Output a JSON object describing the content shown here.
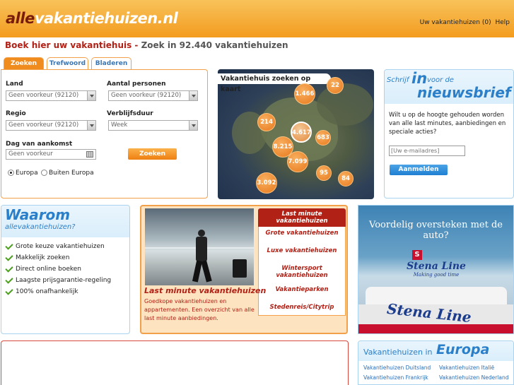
{
  "header": {
    "logo_part1": "alle",
    "logo_part2": "vakantiehuizen.nl",
    "nav_favorites": "Uw vakantiehuizen (0)",
    "nav_help": "Help"
  },
  "headline": {
    "part1": "Boek hier uw vakantiehuis - ",
    "part2": "Zoek in 92.440 vakantiehuizen"
  },
  "search_tabs": [
    "Zoeken",
    "Trefwoord",
    "Bladeren"
  ],
  "search": {
    "land_label": "Land",
    "land_value": "Geen voorkeur (92120)",
    "personen_label": "Aantal personen",
    "personen_value": "Geen voorkeur (92120)",
    "regio_label": "Regio",
    "regio_value": "Geen voorkeur (92120)",
    "verblijfsduur_label": "Verblijfsduur",
    "verblijfsduur_value": "Week",
    "aankomst_label": "Dag van aankomst",
    "aankomst_value": "Geen voorkeur",
    "submit_label": "Zoeken",
    "radio_europa": "Europa",
    "radio_buiten": "Buiten Europa",
    "selected_region": "Europa"
  },
  "map": {
    "title": "Vakantiehuis zoeken op kaart",
    "bubbles": [
      "1.466",
      "22",
      "214",
      "4.617",
      "683",
      "8.215",
      "7.099",
      "3.092",
      "95",
      "84"
    ]
  },
  "newsletter": {
    "title_small1": "Schrijf",
    "title_big": "in",
    "title_small2": "voor de",
    "title_word": "nieuwsbrief",
    "text": "Wilt u op de hoogte gehouden worden van alle last minutes, aanbiedingen en speciale acties?",
    "email_placeholder": "[Uw e-mailadres]",
    "submit_label": "Aanmelden"
  },
  "why": {
    "title": "Waarom",
    "subtitle": "allevakantiehuizen?",
    "items": [
      "Grote keuze vakantiehuizen",
      "Makkelijk zoeken",
      "Direct online boeken",
      "Laagste prijsgarantie-regeling",
      "100% onafhankelijk"
    ]
  },
  "lastminute": {
    "menu": [
      "Last minute vakantiehuizen",
      "Grote vakantiehuizen",
      "Luxe vakantiehuizen",
      "Wintersport vakantiehuizen",
      "Vakantieparken",
      "Stedenreis/Citytrip"
    ],
    "heading": "Last minute vakantiehuizen",
    "text": "Goedkope vakantiehuizen en appartementen. Een overzicht van alle last minute aanbiedingen."
  },
  "ad": {
    "headline": "Voordelig oversteken met de auto?",
    "brand": "Stena Line",
    "tagline": "Making good time",
    "hull_text": "Stena Line"
  },
  "europe": {
    "title_small": "Vakantiehuizen in",
    "title_big": "Europa",
    "links": [
      "Vakantiehuizen Duitsland",
      "Vakantiehuizen Italië",
      "Vakantiehuizen Frankrijk",
      "Vakantiehuizen Nederland"
    ]
  }
}
